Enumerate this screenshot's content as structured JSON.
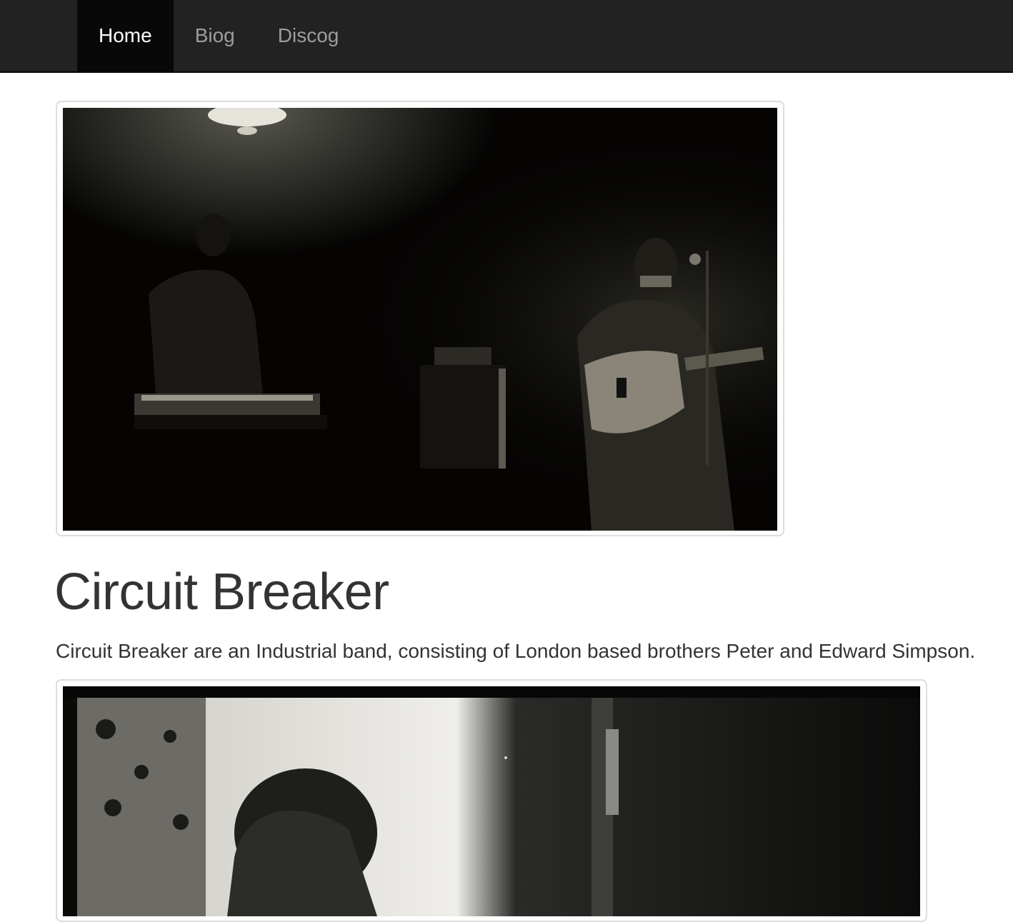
{
  "navbar": {
    "items": [
      {
        "label": "Home",
        "active": true
      },
      {
        "label": "Biog",
        "active": false
      },
      {
        "label": "Discog",
        "active": false
      }
    ]
  },
  "main": {
    "title": "Circuit Breaker",
    "lead": "Circuit Breaker are an Industrial band, consisting of London based brothers Peter and Edward Simpson.",
    "photos": [
      {
        "subject": "band-live-photo"
      },
      {
        "subject": "band-portrait-photo"
      }
    ]
  },
  "colors": {
    "navbar_bg": "#222222",
    "navbar_active_bg": "#080808",
    "nav_text": "#9d9d9d",
    "nav_active_text": "#ffffff",
    "body_text": "#333333",
    "thumbnail_border": "#dddddd"
  }
}
